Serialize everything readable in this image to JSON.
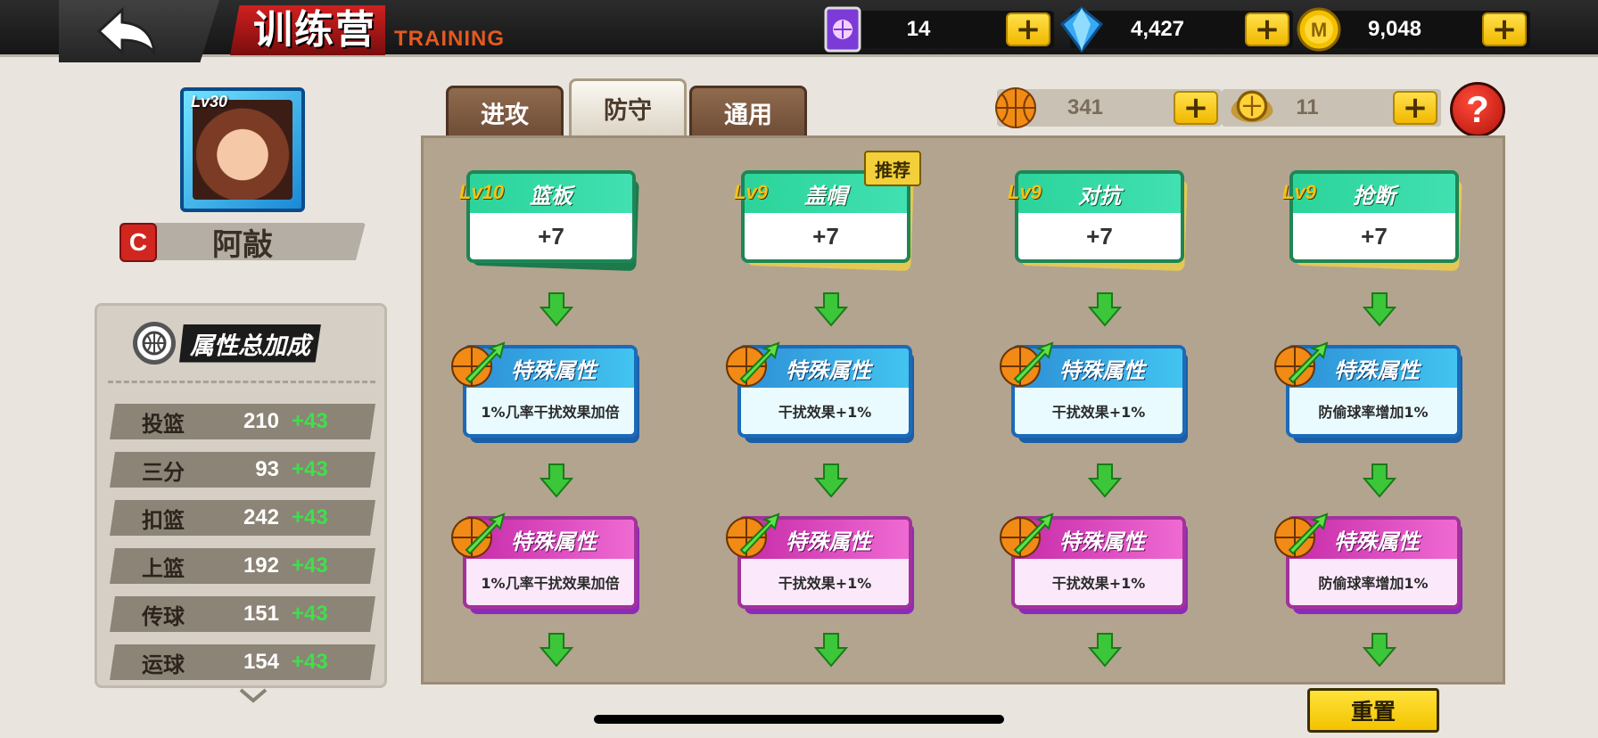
{
  "header": {
    "title_cn": "训练营",
    "title_en": "TRAINING",
    "back_icon": "back-arrow-icon"
  },
  "currencies": [
    {
      "icon": "card-icon",
      "value": "14"
    },
    {
      "icon": "diamond-icon",
      "value": "4,427"
    },
    {
      "icon": "coin-icon",
      "value": "9,048"
    }
  ],
  "player": {
    "level": "Lv30",
    "rank": "C",
    "name": "阿敲"
  },
  "attributes": {
    "title": "属性总加成",
    "rows": [
      {
        "name": "投篮",
        "value": "210",
        "bonus": "+43"
      },
      {
        "name": "三分",
        "value": "93",
        "bonus": "+43"
      },
      {
        "name": "扣篮",
        "value": "242",
        "bonus": "+43"
      },
      {
        "name": "上篮",
        "value": "192",
        "bonus": "+43"
      },
      {
        "name": "传球",
        "value": "151",
        "bonus": "+43"
      },
      {
        "name": "运球",
        "value": "154",
        "bonus": "+43"
      }
    ]
  },
  "tabs": [
    {
      "label": "进攻",
      "active": false
    },
    {
      "label": "防守",
      "active": true
    },
    {
      "label": "通用",
      "active": false
    }
  ],
  "resources": [
    {
      "icon": "basketball-icon",
      "value": "341"
    },
    {
      "icon": "medal-icon",
      "value": "11"
    }
  ],
  "help_label": "?",
  "recommend_tag": "推荐",
  "skills": [
    {
      "level": "Lv10",
      "name": "篮板",
      "bonus": "+7",
      "attr1": {
        "title": "特殊属性",
        "desc": "1%几率干扰效果加倍"
      },
      "attr2": {
        "title": "特殊属性",
        "desc": "1%几率干扰效果加倍"
      }
    },
    {
      "level": "Lv9",
      "name": "盖帽",
      "bonus": "+7",
      "attr1": {
        "title": "特殊属性",
        "desc": "干扰效果+1%"
      },
      "attr2": {
        "title": "特殊属性",
        "desc": "干扰效果+1%"
      }
    },
    {
      "level": "Lv9",
      "name": "对抗",
      "bonus": "+7",
      "attr1": {
        "title": "特殊属性",
        "desc": "干扰效果+1%"
      },
      "attr2": {
        "title": "特殊属性",
        "desc": "干扰效果+1%"
      }
    },
    {
      "level": "Lv9",
      "name": "抢断",
      "bonus": "+7",
      "attr1": {
        "title": "特殊属性",
        "desc": "防偷球率增加1%"
      },
      "attr2": {
        "title": "特殊属性",
        "desc": "防偷球率增加1%"
      }
    }
  ],
  "reset_label": "重置",
  "colors": {
    "accent_yellow": "#f3c300",
    "bonus_green": "#3de04c",
    "card_green": "#2bd49a",
    "card_blue": "#2d8fd6",
    "card_pink": "#c62ba8",
    "title_red": "#d02020"
  }
}
